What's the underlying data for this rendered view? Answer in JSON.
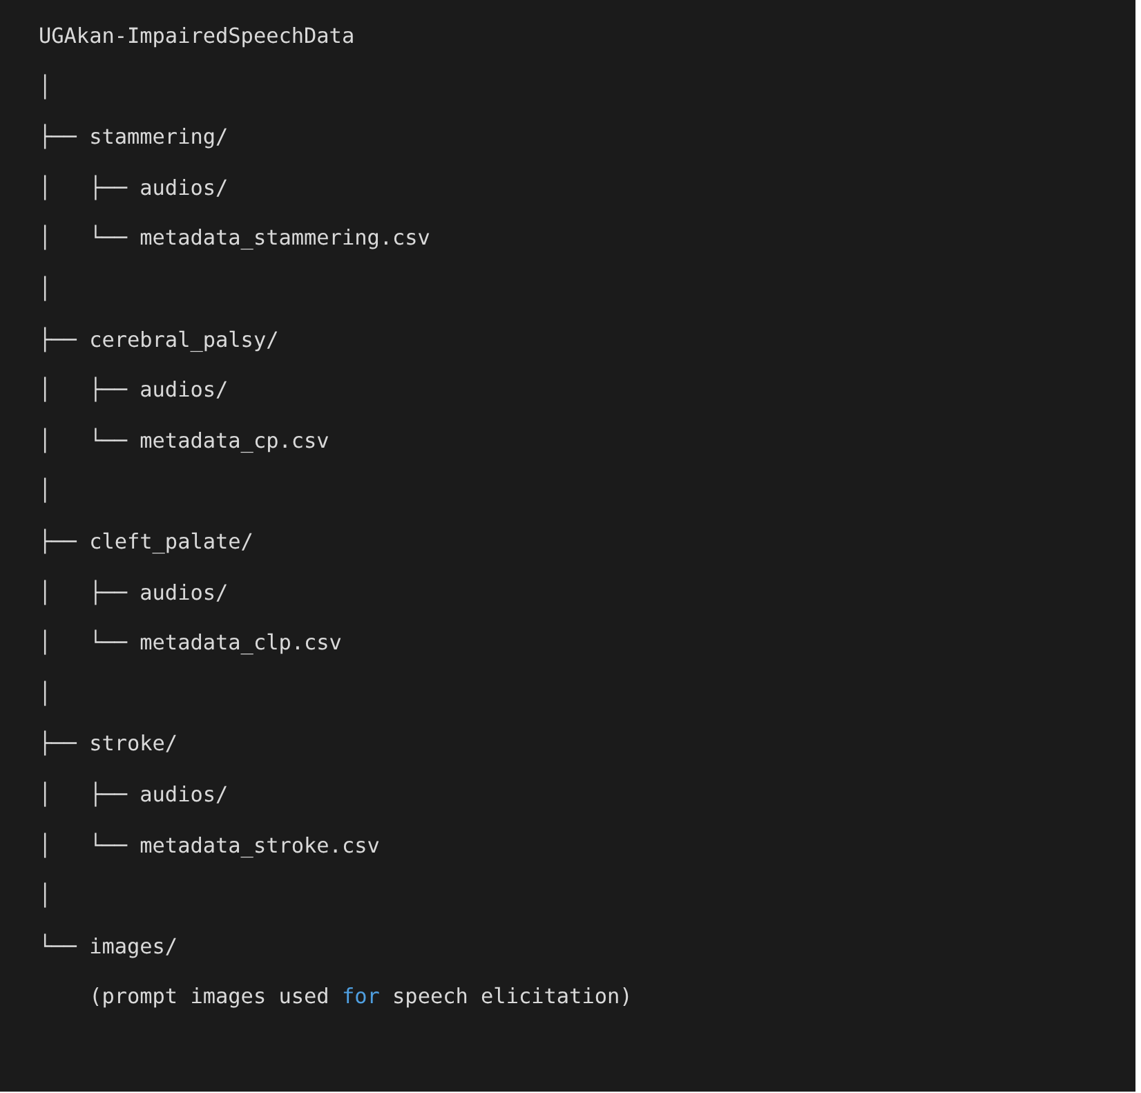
{
  "code_block": {
    "lines": [
      {
        "tokens": [
          {
            "kind": "plain",
            "text": "UGAkan-ImpairedSpeechData"
          }
        ]
      },
      {
        "tokens": [
          {
            "kind": "plain",
            "text": "│"
          }
        ]
      },
      {
        "tokens": [
          {
            "kind": "plain",
            "text": "├── stammering/"
          }
        ]
      },
      {
        "tokens": [
          {
            "kind": "plain",
            "text": "│   ├── audios/"
          }
        ]
      },
      {
        "tokens": [
          {
            "kind": "plain",
            "text": "│   └── metadata_stammering.csv"
          }
        ]
      },
      {
        "tokens": [
          {
            "kind": "plain",
            "text": "│"
          }
        ]
      },
      {
        "tokens": [
          {
            "kind": "plain",
            "text": "├── cerebral_palsy/"
          }
        ]
      },
      {
        "tokens": [
          {
            "kind": "plain",
            "text": "│   ├── audios/"
          }
        ]
      },
      {
        "tokens": [
          {
            "kind": "plain",
            "text": "│   └── metadata_cp.csv"
          }
        ]
      },
      {
        "tokens": [
          {
            "kind": "plain",
            "text": "│"
          }
        ]
      },
      {
        "tokens": [
          {
            "kind": "plain",
            "text": "├── cleft_palate/"
          }
        ]
      },
      {
        "tokens": [
          {
            "kind": "plain",
            "text": "│   ├── audios/"
          }
        ]
      },
      {
        "tokens": [
          {
            "kind": "plain",
            "text": "│   └── metadata_clp.csv"
          }
        ]
      },
      {
        "tokens": [
          {
            "kind": "plain",
            "text": "│"
          }
        ]
      },
      {
        "tokens": [
          {
            "kind": "plain",
            "text": "├── stroke/"
          }
        ]
      },
      {
        "tokens": [
          {
            "kind": "plain",
            "text": "│   ├── audios/"
          }
        ]
      },
      {
        "tokens": [
          {
            "kind": "plain",
            "text": "│   └── metadata_stroke.csv"
          }
        ]
      },
      {
        "tokens": [
          {
            "kind": "plain",
            "text": "│"
          }
        ]
      },
      {
        "tokens": [
          {
            "kind": "plain",
            "text": "└── images/"
          }
        ]
      },
      {
        "tokens": [
          {
            "kind": "plain",
            "text": "    (prompt images used "
          },
          {
            "kind": "keyword",
            "text": "for"
          },
          {
            "kind": "plain",
            "text": " speech elicitation)"
          }
        ]
      }
    ]
  }
}
